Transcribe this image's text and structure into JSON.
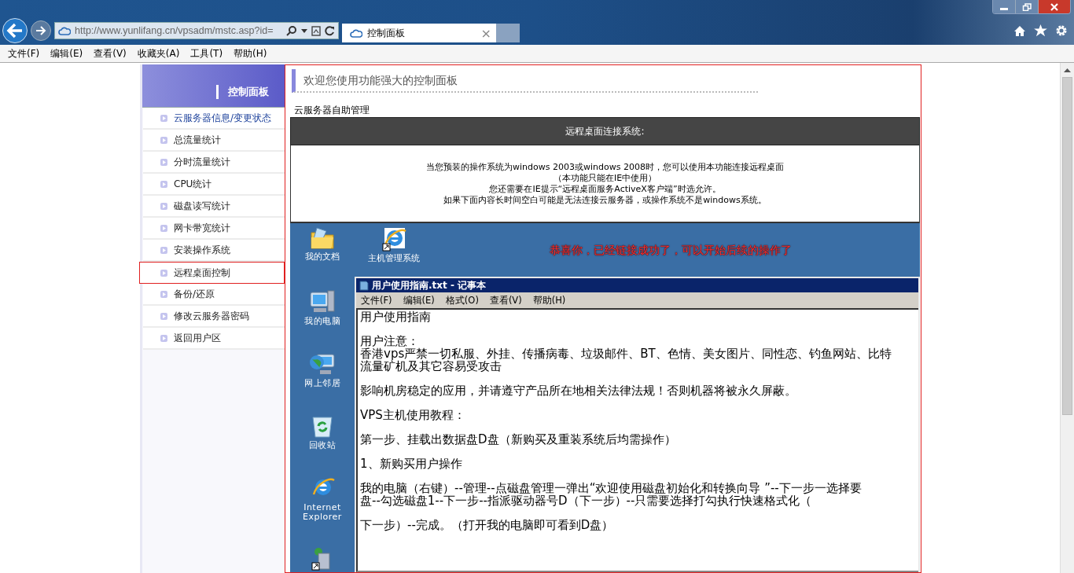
{
  "browser": {
    "address": "http://www.yunlifang.cn/vpsadm/mstc.asp?id=",
    "tabs": [
      {
        "title": "控制面板",
        "selected": true,
        "close": "×"
      }
    ],
    "menu": [
      "文件(F)",
      "编辑(E)",
      "查看(V)",
      "收藏夹(A)",
      "工具(T)",
      "帮助(H)"
    ]
  },
  "sidebar": {
    "title": "控制面板",
    "items": [
      {
        "label": "云服务器信息/变更状态",
        "selected": false,
        "active": true
      },
      {
        "label": "总流量统计",
        "selected": false,
        "active": false
      },
      {
        "label": "分时流量统计",
        "selected": false,
        "active": false
      },
      {
        "label": "CPU统计",
        "selected": false,
        "active": false
      },
      {
        "label": "磁盘读写统计",
        "selected": false,
        "active": false
      },
      {
        "label": "网卡带宽统计",
        "selected": false,
        "active": false
      },
      {
        "label": "安装操作系统",
        "selected": false,
        "active": false
      },
      {
        "label": "远程桌面控制",
        "selected": true,
        "active": false
      },
      {
        "label": "备份/还原",
        "selected": false,
        "active": false
      },
      {
        "label": "修改云服务器密码",
        "selected": false,
        "active": false
      },
      {
        "label": "返回用户区",
        "selected": false,
        "active": false
      }
    ]
  },
  "main": {
    "heading": "欢迎您使用功能强大的控制面板",
    "section_label": "云服务器自助管理",
    "panel_title": "远程桌面连接系统:",
    "notice_lines": [
      "当您预装的操作系统为windows 2003或windows 2008时，您可以使用本功能连接远程桌面",
      "（本功能只能在IE中使用）",
      "您还需要在IE提示“远程桌面服务ActiveX客户端”时选允许。",
      "如果下面内容长时间空白可能是无法连接云服务器，或操作系统不是windows系统。"
    ],
    "remote_desktop": {
      "success_message": "恭喜你，已经链接成功了，可以开始后续的操作了",
      "top_icons": [
        {
          "kind": "folder",
          "label": "我的文档"
        },
        {
          "kind": "ie-shortcut",
          "label": "主机管理系统"
        }
      ],
      "side_icons": [
        {
          "kind": "computer",
          "label": "我的电脑"
        },
        {
          "kind": "network",
          "label": "网上邻居"
        },
        {
          "kind": "recycle",
          "label": "回收站"
        },
        {
          "kind": "ie",
          "label": "Internet Explorer"
        },
        {
          "kind": "server-shortcut"
        }
      ],
      "notepad": {
        "title": "用户使用指南.txt - 记事本",
        "menu": [
          "文件(F)",
          "编辑(E)",
          "格式(O)",
          "查看(V)",
          "帮助(H)"
        ],
        "paragraphs": [
          [
            "用户使用指南"
          ],
          [
            "用户注意：",
            "香港vps严禁一切私服、外挂、传播病毒、垃圾邮件、BT、色情、美女图片、同性恋、钓鱼网站、比特",
            "流量矿机及其它容易受攻击"
          ],
          [
            "影响机房稳定的应用，并请遵守产品所在地相关法律法规！否则机器将被永久屏蔽。"
          ],
          [
            "VPS主机使用教程："
          ],
          [
            "第一步、挂载出数据盘D盘（新购买及重装系统后均需操作）"
          ],
          [
            "1、新购买用户操作"
          ],
          [
            "我的电脑（右键）--管理--点磁盘管理一弹出“欢迎使用磁盘初始化和转换向导 ”--下一步一选择要",
            "盘--勾选磁盘1--下一步--指派驱动器号D（下一步）--只需要选择打勾执行快速格式化（"
          ],
          [
            "下一步）--完成。（打开我的电脑即可看到D盘）"
          ]
        ]
      }
    }
  }
}
